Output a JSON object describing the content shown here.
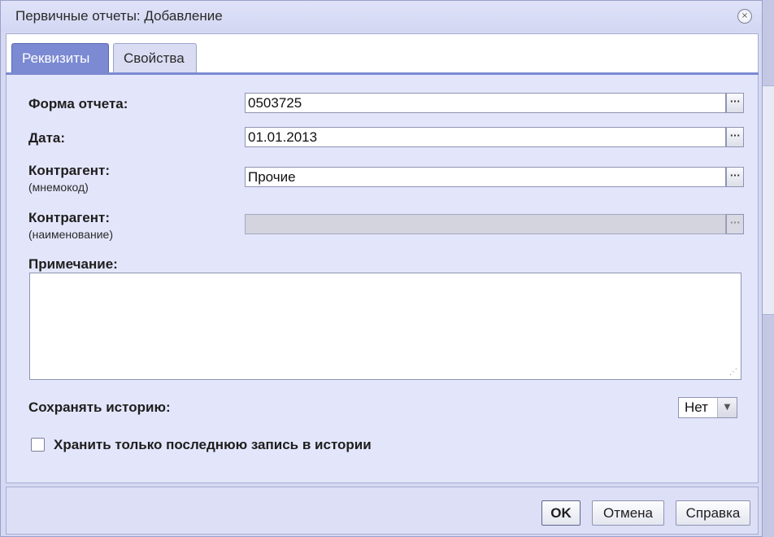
{
  "window": {
    "title": "Первичные отчеты: Добавление",
    "close_icon": "close-icon"
  },
  "tabs": [
    {
      "label": "Реквизиты",
      "active": true
    },
    {
      "label": "Свойства",
      "active": false
    }
  ],
  "form": {
    "report_form": {
      "label": "Форма отчета:",
      "value": "0503725"
    },
    "date": {
      "label": "Дата:",
      "value": "01.01.2013"
    },
    "counterparty_code": {
      "label": "Контрагент:",
      "sublabel": "(мнемокод)",
      "value": "Прочие"
    },
    "counterparty_name": {
      "label": "Контрагент:",
      "sublabel": "(наименование)",
      "value": ""
    },
    "note": {
      "label": "Примечание:",
      "value": ""
    },
    "keep_history": {
      "label": "Сохранять историю:",
      "value": "Нет"
    },
    "last_record_only": {
      "label": "Хранить только последнюю запись в истории",
      "checked": false
    },
    "ellipsis": "···"
  },
  "buttons": {
    "ok": "OK",
    "cancel": "Отмена",
    "help": "Справка"
  },
  "colors": {
    "active_tab": "#7b8ad2",
    "panel_bg": "#e3e6fb",
    "window_bg": "#d6d9f3"
  }
}
